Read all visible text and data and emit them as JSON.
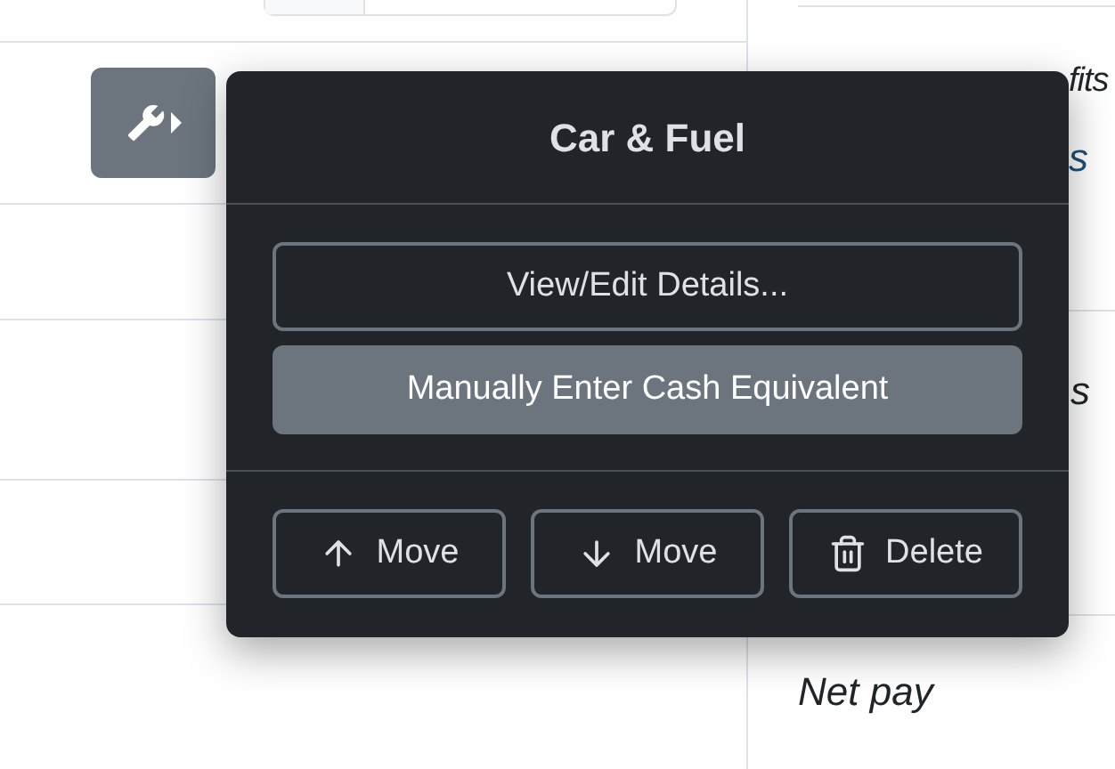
{
  "background": {
    "fragments": [
      "fits",
      "s",
      "s"
    ],
    "net_pay": "Net pay"
  },
  "popover": {
    "title": "Car & Fuel",
    "actions": [
      {
        "label": "View/Edit Details...",
        "selected": false
      },
      {
        "label": "Manually Enter Cash Equivalent",
        "selected": true
      }
    ],
    "footer_buttons": [
      {
        "kind": "up",
        "label": "Move"
      },
      {
        "kind": "down",
        "label": "Move"
      },
      {
        "kind": "delete",
        "label": "Delete"
      }
    ]
  }
}
